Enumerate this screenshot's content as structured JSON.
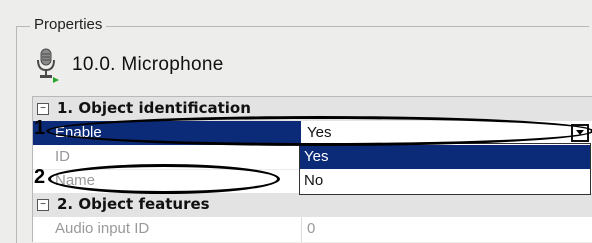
{
  "panel": {
    "title": "Properties",
    "device_title": "10.0. Microphone"
  },
  "grid": {
    "categories": [
      {
        "label": "1. Object identification",
        "toggle": "−"
      },
      {
        "label": "2. Object features",
        "toggle": "−"
      }
    ],
    "rows": {
      "enable": {
        "name": "Enable",
        "value": "Yes"
      },
      "id": {
        "name": "ID",
        "value": ""
      },
      "name": {
        "name": "Name",
        "value": ""
      },
      "audio_input_id": {
        "name": "Audio input ID",
        "value": "0"
      }
    }
  },
  "dropdown": {
    "options": [
      "Yes",
      "No"
    ],
    "selected": "Yes"
  },
  "callouts": [
    "1",
    "2"
  ],
  "colors": {
    "selection": "#0b2a78",
    "background": "#ededeb",
    "category_bg": "#e3e3e3"
  },
  "icons": {
    "device": "microphone-icon",
    "expand": "collapse-toggle-icon",
    "dropdown": "chevron-down-icon"
  }
}
